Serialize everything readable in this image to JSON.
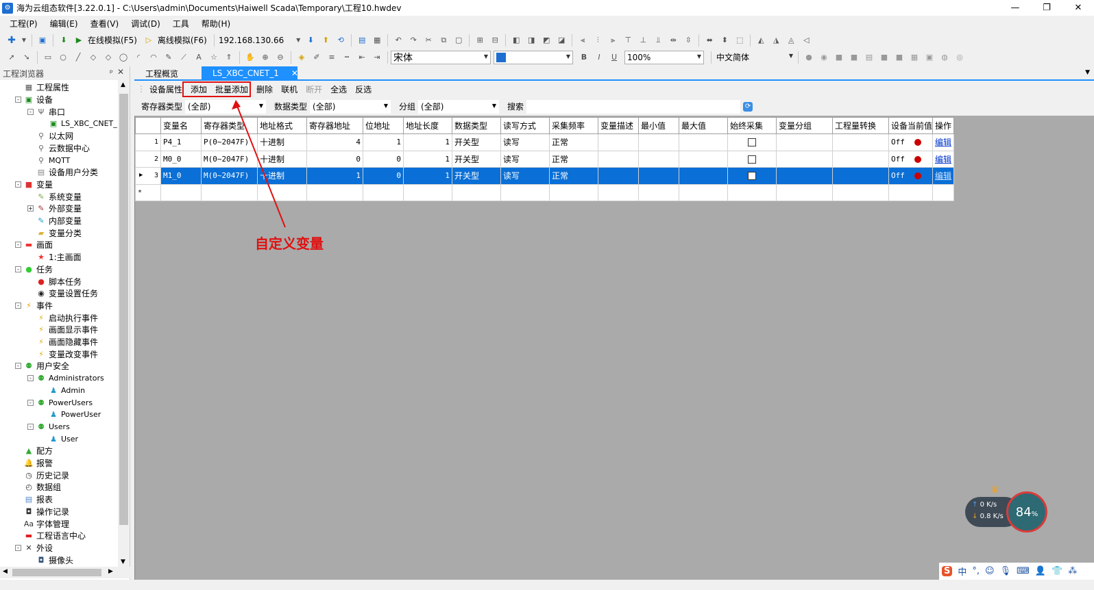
{
  "window": {
    "title": "海为云组态软件[3.22.0.1] - C:\\Users\\admin\\Documents\\Haiwell Scada\\Temporary\\工程10.hwdev",
    "minimize": "—",
    "maximize": "❐",
    "close": "✕"
  },
  "menu": [
    "工程(P)",
    "编辑(E)",
    "查看(V)",
    "调试(D)",
    "工具",
    "帮助(H)"
  ],
  "toolbar1": {
    "online_sim": "在线模拟(F5)",
    "offline_sim": "离线模拟(F6)",
    "ip": "192.168.130.66"
  },
  "toolbar2": {
    "font": "宋体",
    "zoom": "100%",
    "language": "中文简体",
    "bold": "B",
    "italic": "I",
    "underline": "U"
  },
  "left_panel": {
    "title": "工程浏览器",
    "pin": "ᵖ",
    "close": "✕"
  },
  "tree": [
    {
      "label": "工程属性",
      "icon": "properties-icon",
      "level": 0,
      "exp": ""
    },
    {
      "label": "设备",
      "icon": "device-icon",
      "level": 0,
      "exp": "-"
    },
    {
      "label": "串口",
      "icon": "serial-icon",
      "level": 1,
      "exp": "-"
    },
    {
      "label": "LS_XBC_CNET_",
      "icon": "plc-icon",
      "level": 2,
      "exp": ""
    },
    {
      "label": "以太网",
      "icon": "ethernet-icon",
      "level": 1,
      "exp": ""
    },
    {
      "label": "云数据中心",
      "icon": "cloud-icon",
      "level": 1,
      "exp": ""
    },
    {
      "label": "MQTT",
      "icon": "mqtt-icon",
      "level": 1,
      "exp": ""
    },
    {
      "label": "设备用户分类",
      "icon": "category-icon",
      "level": 1,
      "exp": ""
    },
    {
      "label": "变量",
      "icon": "variable-icon",
      "level": 0,
      "exp": "-"
    },
    {
      "label": "系统变量",
      "icon": "sysvar-icon",
      "level": 1,
      "exp": ""
    },
    {
      "label": "外部变量",
      "icon": "extvar-icon",
      "level": 1,
      "exp": "+"
    },
    {
      "label": "内部变量",
      "icon": "intvar-icon",
      "level": 1,
      "exp": ""
    },
    {
      "label": "变量分类",
      "icon": "folder-icon",
      "level": 1,
      "exp": ""
    },
    {
      "label": "画面",
      "icon": "screen-icon",
      "level": 0,
      "exp": "-"
    },
    {
      "label": "1:主画面",
      "icon": "mainscreen-icon",
      "level": 1,
      "exp": ""
    },
    {
      "label": "任务",
      "icon": "task-icon",
      "level": 0,
      "exp": "-"
    },
    {
      "label": "脚本任务",
      "icon": "script-icon",
      "level": 1,
      "exp": ""
    },
    {
      "label": "变量设置任务",
      "icon": "setvar-icon",
      "level": 1,
      "exp": ""
    },
    {
      "label": "事件",
      "icon": "event-icon",
      "level": 0,
      "exp": "-"
    },
    {
      "label": "启动执行事件",
      "icon": "lightning-icon",
      "level": 1,
      "exp": ""
    },
    {
      "label": "画面显示事件",
      "icon": "lightning-icon",
      "level": 1,
      "exp": ""
    },
    {
      "label": "画面隐藏事件",
      "icon": "lightning-icon",
      "level": 1,
      "exp": ""
    },
    {
      "label": "变量改变事件",
      "icon": "lightning-icon",
      "level": 1,
      "exp": ""
    },
    {
      "label": "用户安全",
      "icon": "users-icon",
      "level": 0,
      "exp": "-"
    },
    {
      "label": "Administrators",
      "icon": "group-icon",
      "level": 1,
      "exp": "-"
    },
    {
      "label": "Admin",
      "icon": "user-icon",
      "level": 2,
      "exp": ""
    },
    {
      "label": "PowerUsers",
      "icon": "group-icon",
      "level": 1,
      "exp": "-"
    },
    {
      "label": "PowerUser",
      "icon": "user-icon",
      "level": 2,
      "exp": ""
    },
    {
      "label": "Users",
      "icon": "group-icon",
      "level": 1,
      "exp": "-"
    },
    {
      "label": "User",
      "icon": "user-icon",
      "level": 2,
      "exp": ""
    },
    {
      "label": "配方",
      "icon": "recipe-icon",
      "level": 0,
      "exp": ""
    },
    {
      "label": "报警",
      "icon": "alarm-bell-icon",
      "level": 0,
      "exp": ""
    },
    {
      "label": "历史记录",
      "icon": "history-icon",
      "level": 0,
      "exp": ""
    },
    {
      "label": "数据组",
      "icon": "datagroup-icon",
      "level": 0,
      "exp": ""
    },
    {
      "label": "报表",
      "icon": "report-icon",
      "level": 0,
      "exp": ""
    },
    {
      "label": "操作记录",
      "icon": "oplog-icon",
      "level": 0,
      "exp": ""
    },
    {
      "label": "字体管理",
      "icon": "font-icon",
      "level": 0,
      "exp": ""
    },
    {
      "label": "工程语言中心",
      "icon": "language-icon",
      "level": 0,
      "exp": ""
    },
    {
      "label": "外设",
      "icon": "tools-icon",
      "level": 0,
      "exp": "-"
    },
    {
      "label": "摄像头",
      "icon": "camera-icon",
      "level": 1,
      "exp": ""
    }
  ],
  "tabs": [
    {
      "label": "工程概览",
      "active": false
    },
    {
      "label": "LS_XBC_CNET_1",
      "active": true
    }
  ],
  "tab_close": "✕",
  "content_toolbar": {
    "device_props": "设备属性",
    "add": "添加",
    "batch_add": "批量添加",
    "delete": "删除",
    "connect": "联机",
    "disconnect": "断开",
    "select_all": "全选",
    "invert": "反选"
  },
  "filters": {
    "register_type_label": "寄存器类型",
    "register_type_value": "(全部)",
    "data_type_label": "数据类型",
    "data_type_value": "(全部)",
    "group_label": "分组",
    "group_value": "(全部)",
    "search_label": "搜索"
  },
  "grid": {
    "headers": [
      "变量名",
      "寄存器类型",
      "地址格式",
      "寄存器地址",
      "位地址",
      "地址长度",
      "数据类型",
      "读写方式",
      "采集频率",
      "变量描述",
      "最小值",
      "最大值",
      "始终采集",
      "变量分组",
      "工程量转换",
      "设备当前值",
      "操作"
    ],
    "rows": [
      {
        "no": "1",
        "name": "P4_1",
        "reg_type": "P(0~2047F)",
        "addr_format": "十进制",
        "reg_addr": "4",
        "bit_addr": "1",
        "addr_len": "1",
        "data_type": "开关型",
        "rw": "读写",
        "freq": "正常",
        "desc": "",
        "min": "",
        "max": "",
        "always": false,
        "group": "",
        "conv": "",
        "value": "Off",
        "op": "编辑",
        "selected": false
      },
      {
        "no": "2",
        "name": "M0_0",
        "reg_type": "M(0~2047F)",
        "addr_format": "十进制",
        "reg_addr": "0",
        "bit_addr": "0",
        "addr_len": "1",
        "data_type": "开关型",
        "rw": "读写",
        "freq": "正常",
        "desc": "",
        "min": "",
        "max": "",
        "always": false,
        "group": "",
        "conv": "",
        "value": "Off",
        "op": "编辑",
        "selected": false
      },
      {
        "no": "3",
        "name": "M1_0",
        "reg_type": "M(0~2047F)",
        "addr_format": "十进制",
        "reg_addr": "1",
        "bit_addr": "0",
        "addr_len": "1",
        "data_type": "开关型",
        "rw": "读写",
        "freq": "正常",
        "desc": "",
        "min": "",
        "max": "",
        "always": false,
        "group": "",
        "conv": "",
        "value": "Off",
        "op": "编辑",
        "selected": true
      }
    ],
    "new_row_marker": "*"
  },
  "annotation": {
    "text": "自定义变量",
    "color": "#e01010"
  },
  "net_widget": {
    "up": "0 K/s",
    "down": "0.8 K/s",
    "percent": "84",
    "percent_unit": "%"
  },
  "tray": {
    "ime": "中",
    "punct": "°,"
  },
  "colors": {
    "tab_active": "#1e90ff",
    "row_selected": "#0a6fd6",
    "grid_background": "#aaaaaa"
  }
}
